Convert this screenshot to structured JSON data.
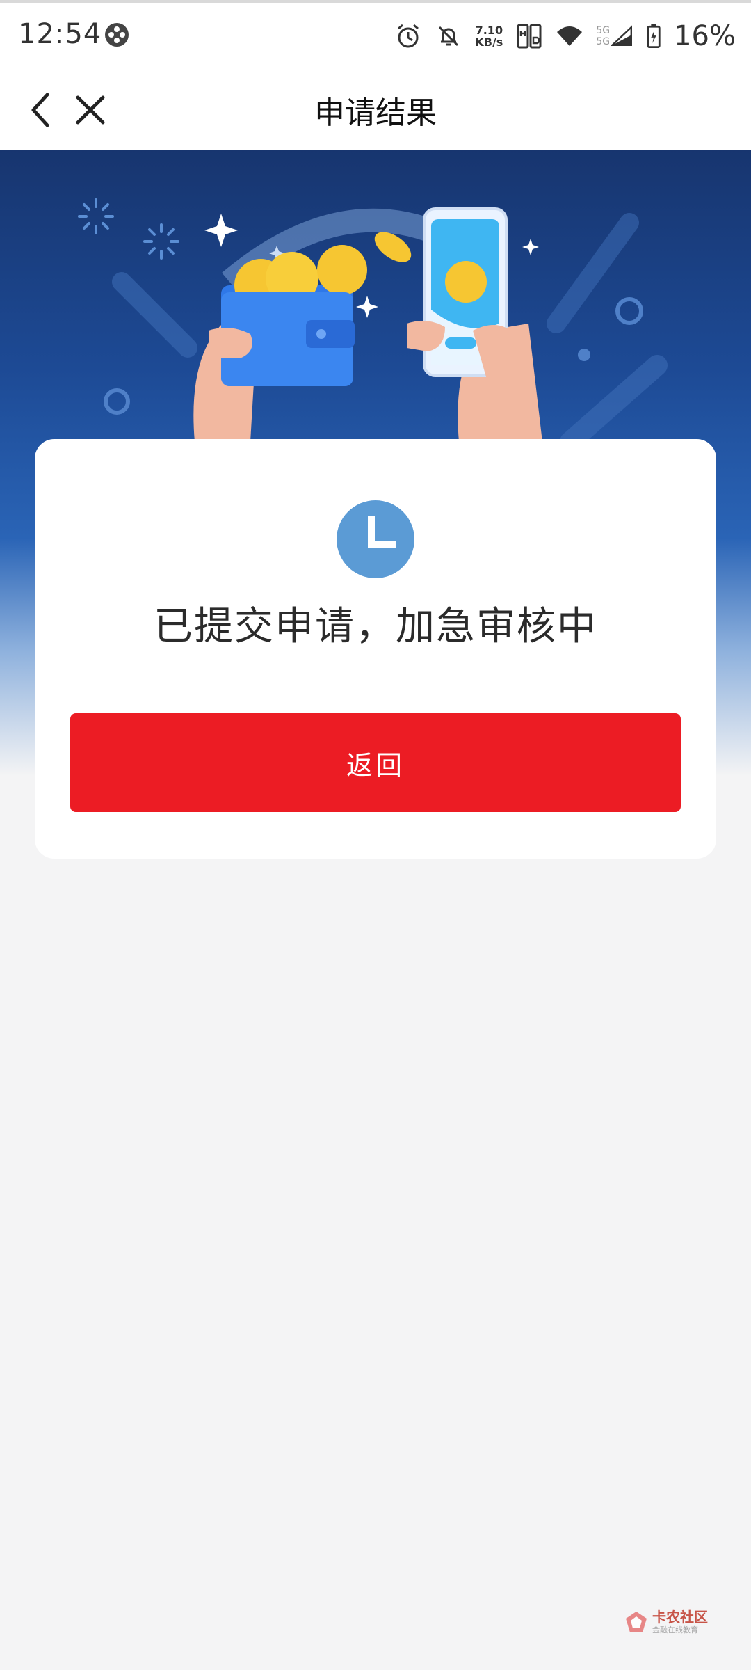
{
  "status_bar": {
    "time": "12:54",
    "net_speed_value": "7.10",
    "net_speed_unit": "KB/s",
    "sim_label_1": "5G",
    "sim_label_2": "5G",
    "battery_percent": "16%"
  },
  "nav": {
    "title": "申请结果",
    "back_icon": "chevron-left-icon",
    "close_icon": "close-icon"
  },
  "result": {
    "status_icon": "clock-icon",
    "message": "已提交申请，加急审核中",
    "button_label": "返回"
  },
  "watermark": {
    "brand": "卡农社区",
    "tagline": "金融在线教育"
  },
  "colors": {
    "primary_button": "#ec1c24",
    "clock_icon": "#5b9bd5",
    "hero_top": "#17356f",
    "background": "#f4f4f5"
  }
}
